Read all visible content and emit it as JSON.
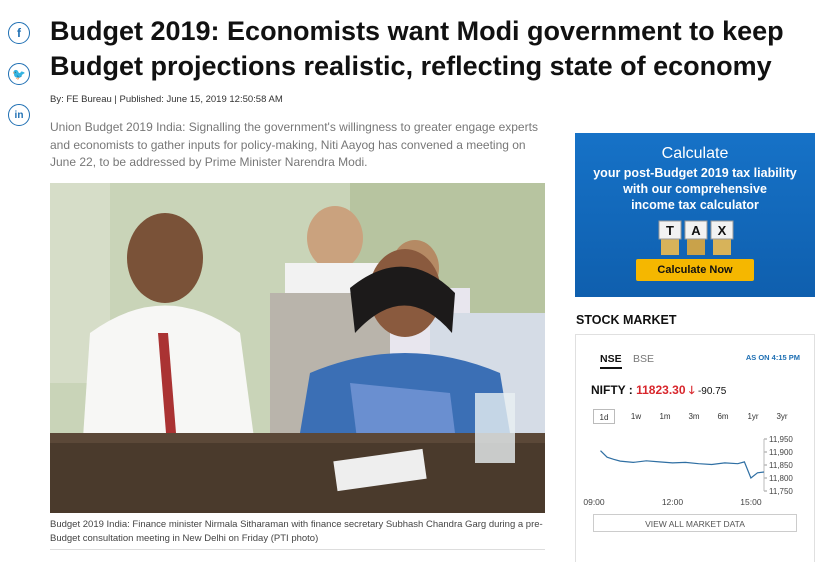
{
  "share": {
    "facebook": "f",
    "twitter": "🐦",
    "linkedin": "in"
  },
  "article": {
    "headline": "Budget 2019: Economists want Modi government to keep Budget projections realistic, reflecting state of economy",
    "byline": "By: FE Bureau | Published: June 15, 2019 12:50:58 AM",
    "summary": "Union Budget 2019 India: Signalling the government's willingness to greater engage experts and economists to gather inputs for policy-making, Niti Aayog has convened a meeting on June 22, to be addressed by Prime Minister Narendra Modi.",
    "caption": "Budget 2019 India: Finance minister Nirmala Sitharaman with finance secretary Subhash Chandra Garg during a pre-Budget consultation meeting in New Delhi on Friday (PTI photo)"
  },
  "ad": {
    "title": "Calculate",
    "subtitle_lines": [
      "your post-Budget 2019 tax liability",
      "with our comprehensive",
      "income tax calculator"
    ],
    "tiles": [
      "T",
      "A",
      "X"
    ],
    "cta": "Calculate Now"
  },
  "stock": {
    "section_title": "STOCK MARKET",
    "tabs": [
      "NSE",
      "BSE"
    ],
    "active_tab": "NSE",
    "as_of": "AS ON 4:15 PM",
    "index_name": "NIFTY :",
    "index_value": "11823.30",
    "change": "-90.75",
    "ranges": [
      "1d",
      "1w",
      "1m",
      "3m",
      "6m",
      "1yr",
      "3yr"
    ],
    "active_range": "1d",
    "view_all": "VIEW ALL MARKET DATA",
    "colors": {
      "down": "#d8262c",
      "line": "#2f6fa3",
      "accent": "#1e6fb3"
    }
  },
  "chart_data": {
    "type": "line",
    "x_ticks": [
      "09:00",
      "12:00",
      "15:00"
    ],
    "y_ticks": [
      "11,950",
      "11,900",
      "11,850",
      "11,800",
      "11,750"
    ],
    "ylim": [
      11750,
      11950
    ],
    "x": [
      "09:15",
      "09:30",
      "09:45",
      "10:00",
      "10:30",
      "11:00",
      "11:30",
      "12:00",
      "12:30",
      "13:00",
      "13:30",
      "14:00",
      "14:30",
      "14:45",
      "15:00",
      "15:15",
      "15:30"
    ],
    "values": [
      11905,
      11880,
      11872,
      11865,
      11860,
      11866,
      11862,
      11858,
      11860,
      11855,
      11852,
      11858,
      11855,
      11862,
      11800,
      11820,
      11823
    ]
  }
}
